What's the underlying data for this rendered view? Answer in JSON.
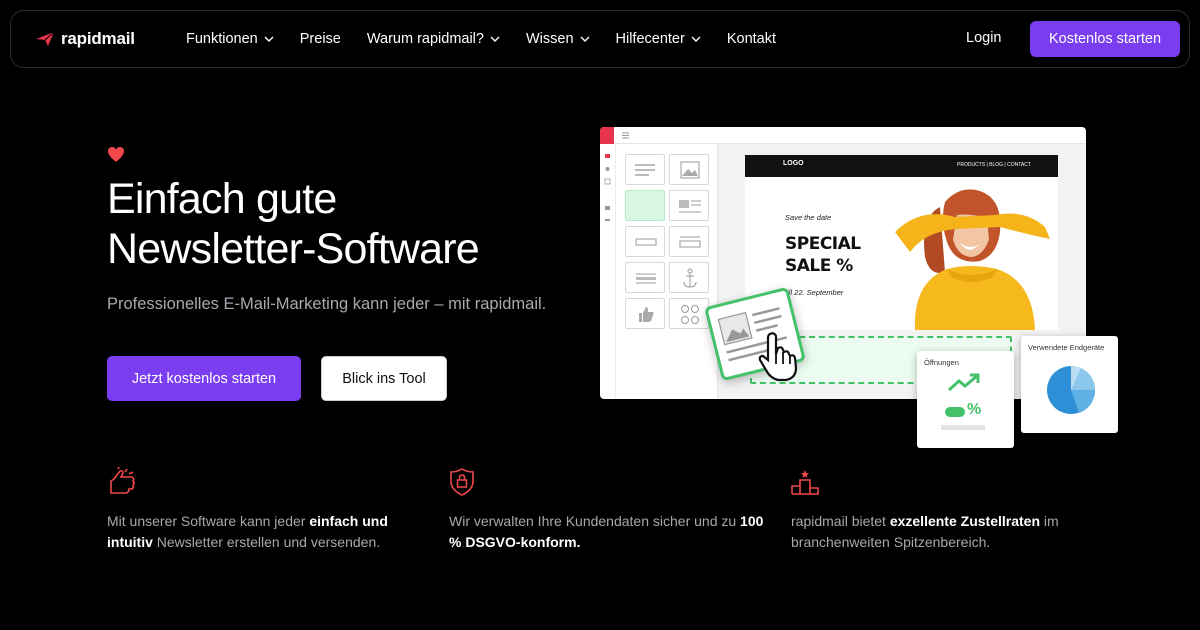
{
  "brand": {
    "name": "rapidmail",
    "accent": "#7b3df0",
    "icon_color": "#e6344a"
  },
  "nav": {
    "items": [
      {
        "label": "Funktionen",
        "dropdown": true
      },
      {
        "label": "Preise",
        "dropdown": false
      },
      {
        "label": "Warum rapidmail?",
        "dropdown": true
      },
      {
        "label": "Wissen",
        "dropdown": true
      },
      {
        "label": "Hilfecenter",
        "dropdown": true
      },
      {
        "label": "Kontakt",
        "dropdown": false
      }
    ],
    "login": "Login",
    "cta": "Kostenlos starten"
  },
  "hero": {
    "title_line1": "Einfach gute",
    "title_line2": "Newsletter-Software",
    "subtitle": "Professionelles E-Mail-Marketing kann jeder – mit rapidmail.",
    "primary_button": "Jetzt kostenlos starten",
    "secondary_button": "Blick ins Tool"
  },
  "mockup": {
    "email_logo": "LOGO",
    "email_nav": "PRODUCTS | BLOG | CONTACT",
    "save_the_date": "Save the date",
    "special_line1": "SPECIAL",
    "special_line2": "SALE %",
    "till": "till 22. September",
    "stat_opens_label": "Öffnungen",
    "stat_opens_symbol": "%",
    "stat_devices_label": "Verwendete Endgeräte"
  },
  "features": [
    {
      "icon": "pointing-hand-icon",
      "before": "Mit unserer Software kann jeder ",
      "strong": "einfach und intuitiv",
      "after": " Newsletter erstellen und versenden."
    },
    {
      "icon": "shield-lock-icon",
      "before": "Wir verwalten Ihre Kundendaten sicher und zu ",
      "strong": "100 % DSGVO-konform.",
      "after": ""
    },
    {
      "icon": "podium-icon",
      "before": "rapidmail bietet ",
      "strong": "exzellente Zustellraten",
      "after": " im branchenweiten Spitzenbereich."
    }
  ]
}
